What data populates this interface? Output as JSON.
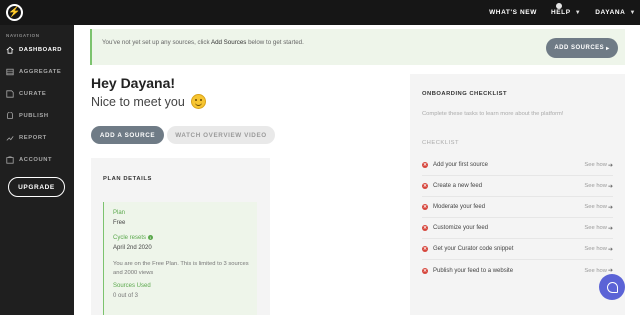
{
  "topbar": {
    "logo_glyph": "⚡",
    "whats_new": "WHAT'S NEW",
    "help": "HELP",
    "user": "DAYANA"
  },
  "sidebar": {
    "heading": "NAVIGATION",
    "items": [
      {
        "label": "DASHBOARD",
        "icon": "home-icon",
        "active": true
      },
      {
        "label": "AGGREGATE",
        "icon": "aggregate-icon",
        "active": false
      },
      {
        "label": "CURATE",
        "icon": "curate-icon",
        "active": false
      },
      {
        "label": "PUBLISH",
        "icon": "publish-icon",
        "active": false
      },
      {
        "label": "REPORT",
        "icon": "report-icon",
        "active": false
      },
      {
        "label": "ACCOUNT",
        "icon": "account-icon",
        "active": false
      }
    ],
    "upgrade": "UPGRADE"
  },
  "banner": {
    "text_before": "You've not yet set up any sources, click ",
    "text_link": "Add Sources",
    "text_after": " below to get started.",
    "button": "ADD SOURCES"
  },
  "greeting": {
    "title": "Hey Dayana!",
    "subtitle": "Nice to meet you"
  },
  "actions": {
    "add_source": "ADD A SOURCE",
    "watch_video": "WATCH OVERVIEW VIDEO"
  },
  "plan": {
    "heading": "PLAN DETAILS",
    "plan_label": "Plan",
    "plan_value": "Free",
    "cycle_label": "Cycle resets",
    "cycle_value": "April 2nd 2020",
    "description": "You are on the Free Plan. This is limited to 3 sources and 2000 views",
    "sources_label": "Sources Used",
    "sources_value": "0 out of 3"
  },
  "checklist": {
    "title": "ONBOARDING CHECKLIST",
    "subtitle": "Complete these tasks to learn more about the platform!",
    "label": "CHECKLIST",
    "see_how": "See how",
    "items": [
      "Add your first source",
      "Create a new feed",
      "Moderate your feed",
      "Customize your feed",
      "Get your Curator code snippet",
      "Publish your feed to a website"
    ]
  },
  "colors": {
    "accent_green": "#7cc36e",
    "button_grey": "#6f7b86",
    "status_red": "#d6453b",
    "chat_purple": "#5b63d6"
  }
}
